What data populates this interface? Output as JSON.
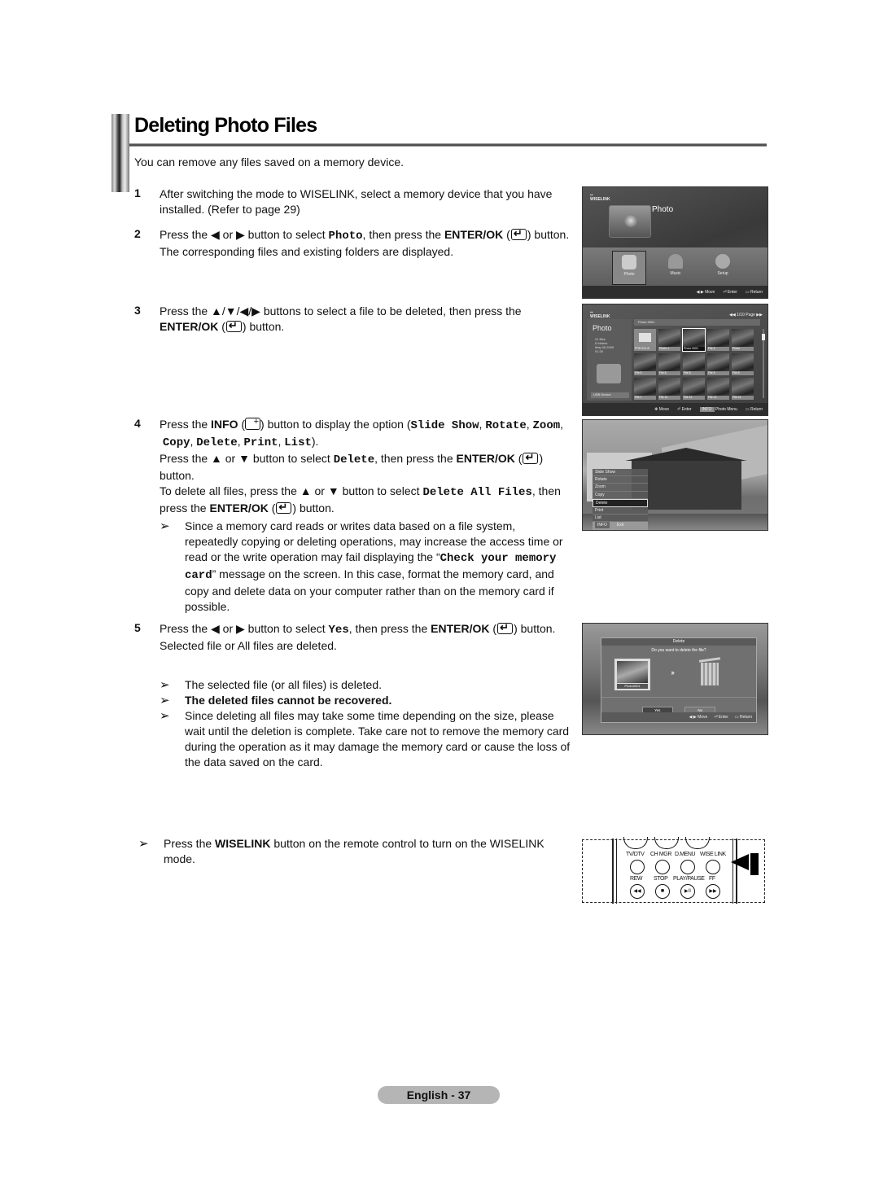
{
  "page": {
    "title": "Deleting Photo Files",
    "intro": "You can remove any files saved on a memory device.",
    "footer": "English - 37"
  },
  "steps": [
    {
      "num": "1",
      "text": "After switching the mode to WISELINK, select a memory device that you have installed. (Refer to page 29)"
    },
    {
      "num": "2",
      "a": "Press the ◀ or ▶ button to select ",
      "code": "Photo",
      "b": ", then press the ",
      "bold": "ENTER/OK",
      "c": " button.",
      "line2": "The corresponding files and existing folders are displayed."
    },
    {
      "num": "3",
      "a": "Press the ▲/▼/◀/▶ buttons to select a file to be deleted, then press the ",
      "bold": "ENTER/OK",
      "c": " button."
    },
    {
      "num": "4",
      "a": "Press the ",
      "bold_info": "INFO",
      "b": " button to display the option (",
      "options": [
        "Slide Show",
        "Rotate",
        "Zoom",
        "Copy",
        "Delete",
        "Print",
        "List"
      ],
      "c": ").",
      "line2a": "Press the ▲ or ▼ button to select ",
      "line2code": "Delete",
      "line2b": ", then press the ",
      "bold": "ENTER/OK",
      "line2c": " button.",
      "line3a": "To delete all files, press the ▲ or ▼ button to select ",
      "line3code": "Delete All Files",
      "line3b": ", then press the ",
      "line3c": " button.",
      "note_a": "Since a memory card reads or writes data based on a file system, repeatedly copying or deleting operations, may increase the access time or read or the write operation may fail displaying the “",
      "note_code": "Check your memory card",
      "note_b": "” message on the screen. In this case, format the memory card, and copy and delete data on your computer rather than on the memory card if possible."
    },
    {
      "num": "5",
      "a": "Press the ◀ or ▶ button to select ",
      "code": "Yes",
      "b": ", then press the ",
      "bold": "ENTER/OK",
      "c": " button.",
      "line2": "Selected file or All files are deleted.",
      "notes": [
        "The selected file (or all files) is deleted.",
        "The deleted files cannot be recovered.",
        "Since deleting all files may take some time depending on the size, please wait until the deletion is complete. Take care not to remove the memory card during the operation as it may damage the memory card or cause the loss of the data saved on the card."
      ]
    }
  ],
  "final_note": {
    "a": "Press the ",
    "bold": "WISELINK",
    "b": " button on the remote control to turn on the WISELINK mode."
  },
  "arrow_glyph": "➢",
  "screens": {
    "main_menu": {
      "logo": "WISELINK",
      "title": "Photo",
      "items": [
        "Photo",
        "Music",
        "Setup"
      ],
      "selected": "Photo",
      "nav": [
        "◀ ▶ Move",
        "Enter",
        "Return"
      ]
    },
    "browser": {
      "logo": "WISELINK",
      "page": "◀◀ 1/10 Page ▶▶",
      "side_title": "Photo",
      "meta": [
        "21 files",
        "6 folders",
        "May 05,2005",
        "01:30"
      ],
      "device": "USB Device",
      "path": "Photo 0001",
      "thumbs": [
        "PREVIOUS",
        "Photo 1",
        "Photo 0001",
        "File 2",
        "Photo",
        "File 5",
        "File 6",
        "File 8",
        "File 9",
        "File 8",
        "File 1",
        "File 11",
        "File 12",
        "File 12",
        "File 14"
      ],
      "selected_index": 2,
      "nav": [
        "Move",
        "Enter",
        "INFO",
        "Photo Menu",
        "Return"
      ]
    },
    "options": {
      "items": [
        "Slide Show",
        "Rotate",
        "Zoom",
        "Copy",
        "Delete",
        "Print",
        "List"
      ],
      "selected": "Delete",
      "footer_key": "INFO",
      "footer_label": "Exit"
    },
    "confirm": {
      "title": "Delete",
      "question": "Do you want to delete the file?",
      "filename": "Photo0001",
      "yes": "Yes",
      "no": "No",
      "nav": [
        "◀ ▶ Move",
        "Enter",
        "Return"
      ]
    }
  },
  "remote": {
    "labels_row1": [
      "TV/DTV",
      "CH MGR",
      "D.MENU",
      "WISE LINK"
    ],
    "labels_row2": [
      "REW",
      "STOP",
      "PLAY/PAUSE",
      "FF"
    ],
    "glyphs_row2": [
      "◀◀",
      "■",
      "▶II",
      "▶▶"
    ]
  }
}
